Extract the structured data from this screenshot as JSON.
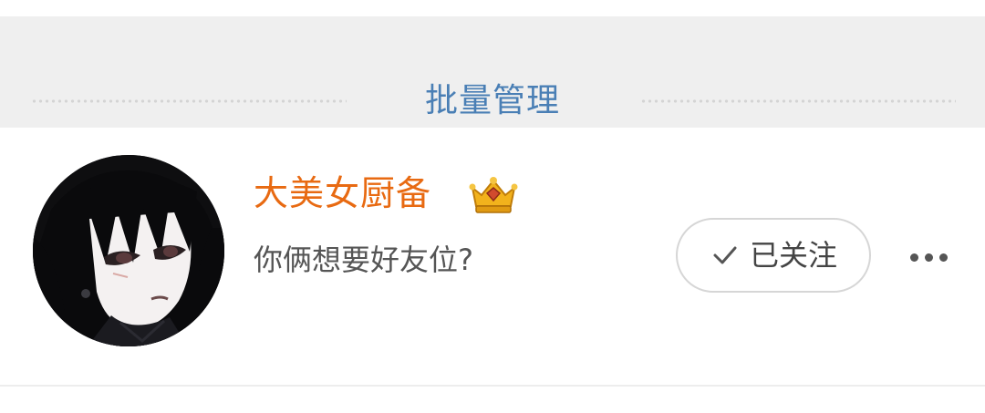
{
  "batch_manage": {
    "label": "批量管理"
  },
  "user": {
    "name": "大美女厨备",
    "bio": "你俩想要好友位?",
    "badge_icon": "crown-vip-badge-icon",
    "avatar_desc": "anime-style portrait avatar"
  },
  "follow": {
    "label": "已关注",
    "icon": "check-icon"
  },
  "more": {
    "icon": "more-dots-icon"
  },
  "colors": {
    "username": "#e86a12",
    "batch_label": "#4a7fb5",
    "bar_background": "#efefef",
    "bio_text": "#555555"
  }
}
